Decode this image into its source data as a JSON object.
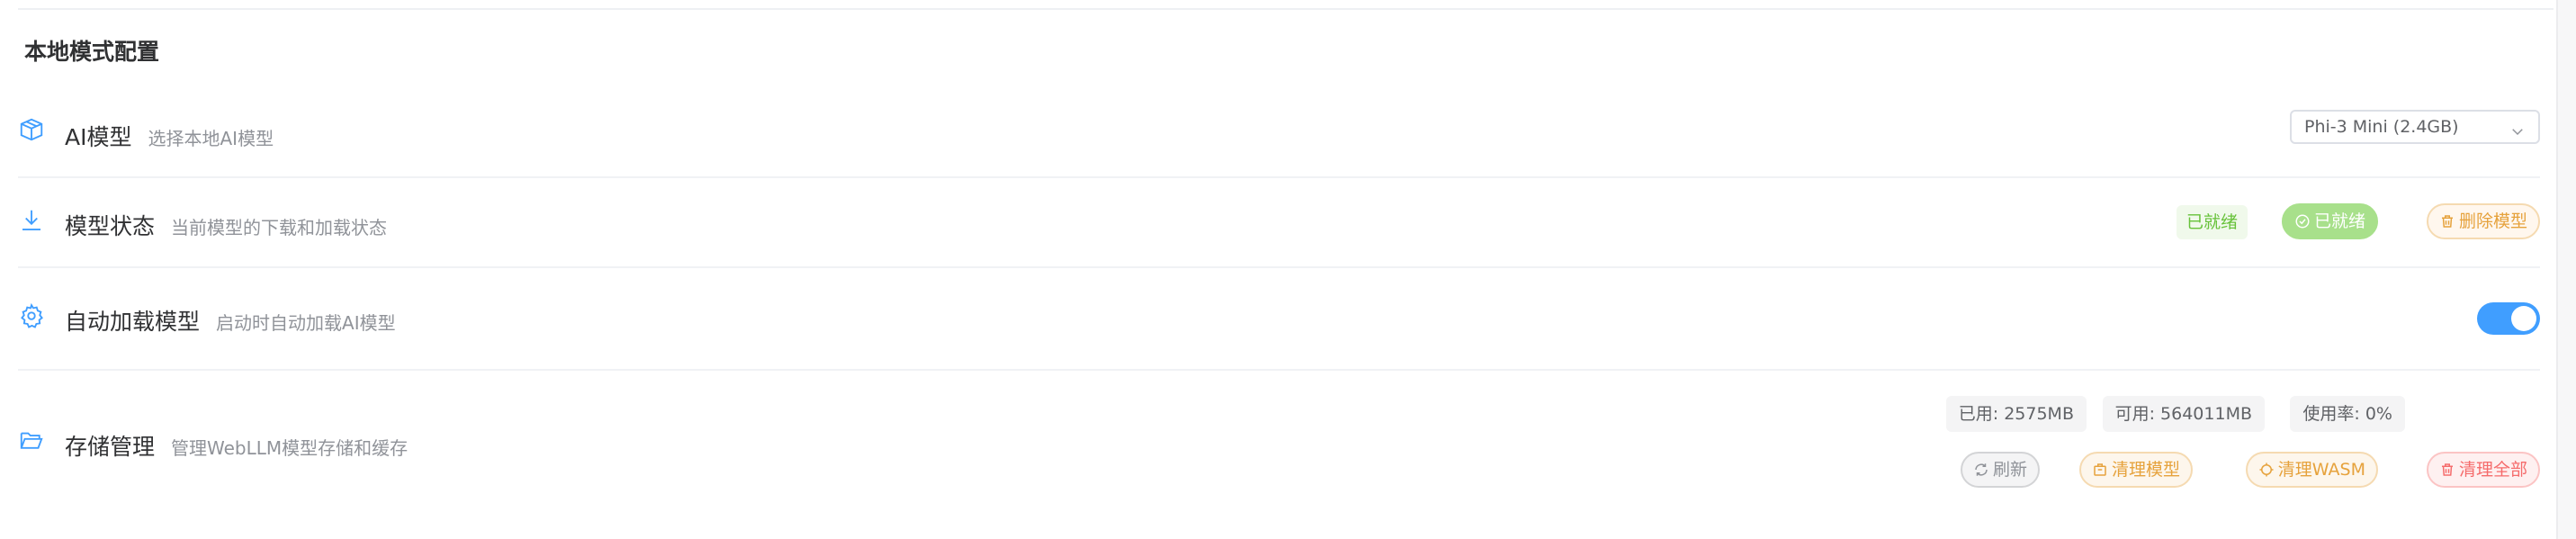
{
  "section": {
    "title": "本地模式配置"
  },
  "colors": {
    "primary": "#409eff",
    "success": "#67c23a",
    "warning": "#e6a23c",
    "danger": "#f56c6c",
    "info": "#909399"
  },
  "rows": [
    {
      "icon": "box-icon",
      "title": "AI模型",
      "description": "选择本地AI模型",
      "control": {
        "type": "select",
        "value": "Phi-3 Mini (2.4GB)"
      }
    },
    {
      "icon": "download-icon",
      "title": "模型状态",
      "description": "当前模型的下载和加载状态",
      "status_tag": "已就绪",
      "ready_button": "已就绪",
      "delete_button": "删除模型"
    },
    {
      "icon": "gear-icon",
      "title": "自动加载模型",
      "description": "启动时自动加载AI模型",
      "toggle_on": true
    },
    {
      "icon": "folder-open-icon",
      "title": "存储管理",
      "description": "管理WebLLM模型存储和缓存",
      "stats": {
        "used": "已用: 2575MB",
        "available": "可用: 564011MB",
        "usage": "使用率: 0%"
      },
      "buttons": {
        "refresh": "刷新",
        "clear_models": "清理模型",
        "clear_wasm": "清理WASM",
        "clear_all": "清理全部"
      }
    }
  ]
}
